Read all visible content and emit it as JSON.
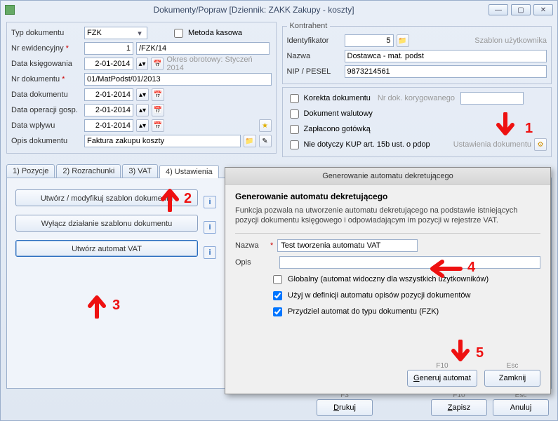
{
  "title": "Dokumenty/Popraw [Dziennik: ZAKK  Zakupy - koszty]",
  "left": {
    "typ_dokumentu_label": "Typ dokumentu",
    "typ_dokumentu_value": "FZK",
    "metoda_kasowa": "Metoda kasowa",
    "nr_ewid_label": "Nr ewidencyjny",
    "nr_ewid_value": "1",
    "nr_ewid_suffix": "/FZK/14",
    "data_ksieg_label": "Data księgowania",
    "data_ksieg_value": "2-01-2014",
    "okres_hint": "Okres obrotowy: Styczeń 2014",
    "nr_dok_label": "Nr dokumentu",
    "nr_dok_value": "01/MatPodst/01/2013",
    "data_dok_label": "Data dokumentu",
    "data_dok_value": "2-01-2014",
    "data_oper_label": "Data operacji gosp.",
    "data_oper_value": "2-01-2014",
    "data_wplywu_label": "Data wpływu",
    "data_wplywu_value": "2-01-2014",
    "opis_label": "Opis dokumentu",
    "opis_value": "Faktura zakupu koszty"
  },
  "right": {
    "legend": "Kontrahent",
    "ident_label": "Identyfikator",
    "ident_value": "5",
    "szablon_user": "Szablon użytkownika",
    "nazwa_label": "Nazwa",
    "nazwa_value": "Dostawca - mat. podst",
    "nip_label": "NIP / PESEL",
    "nip_value": "9873214561",
    "korekta": "Korekta dokumentu",
    "nr_koryg_label": "Nr dok. korygowanego",
    "walutowy": "Dokument walutowy",
    "gotowka": "Zapłacono gotówką",
    "nie_kup": "Nie dotyczy KUP art. 15b ust. o pdop",
    "ustawienia": "Ustawienia dokumentu"
  },
  "tabs": {
    "t1": "1) Pozycje",
    "t2": "2) Rozrachunki",
    "t3": "3) VAT",
    "t4": "4) Ustawienia"
  },
  "settings_tab": {
    "btn1": "Utwórz / modyfikuj szablon dokumentu",
    "btn2": "Wyłącz działanie szablonu dokumentu",
    "btn3": "Utwórz automat VAT"
  },
  "footer": {
    "drukuj": "Drukuj",
    "drukuj_key": "F3",
    "zapisz": "Zapisz",
    "zapisz_key": "F10",
    "anuluj": "Anuluj",
    "anuluj_key": "Esc"
  },
  "dialog": {
    "title": "Generowanie automatu dekretującego",
    "heading": "Generowanie automatu dekretującego",
    "desc": "Funkcja pozwala na utworzenie automatu dekretującego na podstawie istniejących pozycji dokumentu księgowego i odpowiadającym im pozycji w rejestrze VAT.",
    "nazwa_label": "Nazwa",
    "nazwa_value": "Test tworzenia automatu VAT",
    "opis_label": "Opis",
    "opis_value": "",
    "chk_global": "Globalny (automat widoczny dla wszystkich użytkowników)",
    "chk_opis": "Użyj w definicji automatu opisów pozycji dokumentów",
    "chk_typ": "Przydziel automat do typu dokumentu (FZK)",
    "gen": "Generuj automat",
    "gen_key": "F10",
    "close": "Zamknij",
    "close_key": "Esc"
  },
  "ann": {
    "n1": "1",
    "n2": "2",
    "n3": "3",
    "n4": "4",
    "n5": "5"
  }
}
